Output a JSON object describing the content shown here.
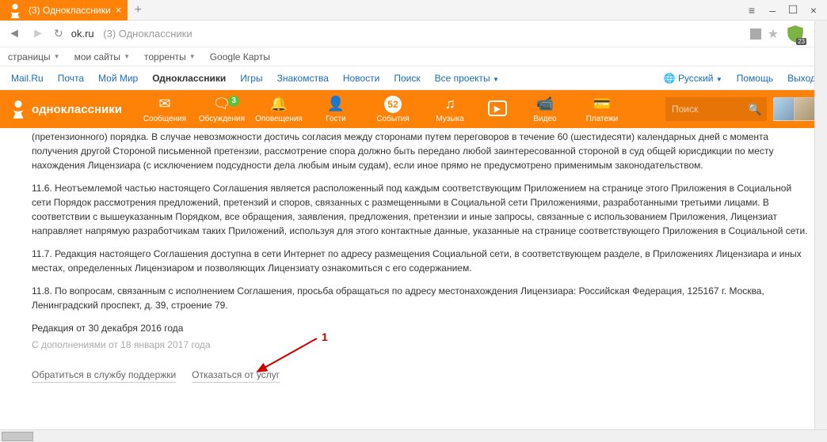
{
  "tab": {
    "title": "(3) Одноклассники"
  },
  "address": {
    "url": "ok.ru",
    "title_suffix": "(3) Одноклассники",
    "shield_badge": "23"
  },
  "bookmarks": [
    "страницы",
    "мои сайты",
    "торренты",
    "Google Карты"
  ],
  "mailru": {
    "links": [
      "Mail.Ru",
      "Почта",
      "Мой Мир",
      "Одноклассники",
      "Игры",
      "Знакомства",
      "Новости",
      "Поиск",
      "Все проекты"
    ],
    "active_index": 3,
    "lang": "Русский",
    "help": "Помощь",
    "exit": "Выход"
  },
  "oknav": {
    "logo": "одноклассники",
    "items": [
      {
        "label": "Сообщения",
        "icon": "✉"
      },
      {
        "label": "Обсуждения",
        "icon": "💬",
        "badge": "3"
      },
      {
        "label": "Оповещения",
        "icon": "🔔"
      },
      {
        "label": "Гости",
        "icon": "👤"
      },
      {
        "label": "События",
        "icon": "52"
      },
      {
        "label": "Музыка",
        "icon": "♫"
      },
      {
        "label": "  ",
        "icon": "▶"
      },
      {
        "label": "Видео",
        "icon": "📹"
      },
      {
        "label": "Платежи",
        "icon": "💳"
      }
    ],
    "search_placeholder": "Поиск"
  },
  "content": {
    "p1": "(претензионного) порядка. В случае невозможности достичь согласия между сторонами путем переговоров в течение 60 (шестидесяти) календарных дней с момента получения другой Стороной письменной претензии, рассмотрение спора должно быть передано любой заинтересованной стороной в суд общей юрисдикции по месту нахождения Лицензиара (с исключением подсудности дела любым иным судам), если иное прямо не предусмотрено применимым законодательством.",
    "p2": "11.6. Неотъемлемой частью настоящего Соглашения является расположенный под каждым соответствующим Приложением на странице этого Приложения в Социальной сети Порядок рассмотрения предложений, претензий и споров, связанных с размещенными в Социальной сети Приложениями, разработанными третьими лицами. В соответствии с вышеуказанным Порядком, все обращения, заявления, предложения, претензии и иные запросы, связанные с использованием Приложения, Лицензиат направляет напрямую разработчикам таких Приложений, используя для этого контактные данные, указанные на странице соответствующего Приложения в Социальной сети.",
    "p3": "11.7. Редакция настоящего Соглашения доступна в сети Интернет по адресу размещения Социальной сети, в соответствующем разделе, в Приложениях Лицензиара и иных местах, определенных Лицензиаром и позволяющих Лицензиату ознакомиться с его содержанием.",
    "p4": "11.8. По вопросам, связанным с исполнением Соглашения, просьба обращаться по адресу местонахождения Лицензиара: Российская Федерация, 125167 г. Москва, Ленинградский проспект, д. 39, строение 79.",
    "date": "Редакция от 30 декабря 2016 года",
    "sub": "С дополнениями от 18 января 2017 года",
    "link_support": "Обратиться в службу поддержки",
    "link_decline": "Отказаться от услуг"
  },
  "annotation": {
    "num": "1"
  }
}
